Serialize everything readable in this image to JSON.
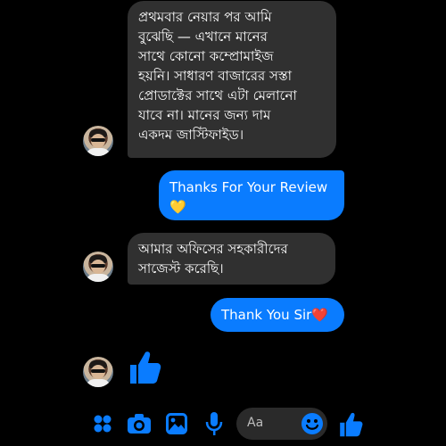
{
  "messages": [
    {
      "from": "them",
      "lines": [
        "প্রথমবার নেয়ার পর আমি",
        "বুঝেছি — এখানে মানের",
        "সাথে কোনো কম্প্রোমাইজ",
        "হয়নি। সাধারণ বাজারের সস্তা",
        "প্রোডাক্টের সাথে এটা মেলানো",
        "যাবে না। মানের জন্য দাম",
        "একদম জাস্টিফাইড।"
      ]
    },
    {
      "from": "me",
      "lines": [
        "Thanks For Your Review",
        "💛"
      ]
    },
    {
      "from": "them",
      "lines": [
        "আমার অফিসের সহকারীদের",
        "সাজেস্ট করেছি।"
      ]
    },
    {
      "from": "me",
      "lines": [
        "Thank You Sir❤️"
      ]
    },
    {
      "from": "them",
      "type": "like",
      "icon": "thumbs-up-icon"
    }
  ],
  "composer": {
    "placeholder": "Aa",
    "accent": "#0a7cff",
    "icons": [
      "apps-icon",
      "camera-icon",
      "image-icon",
      "microphone-icon",
      "emoji-icon",
      "thumbs-up-icon"
    ]
  }
}
